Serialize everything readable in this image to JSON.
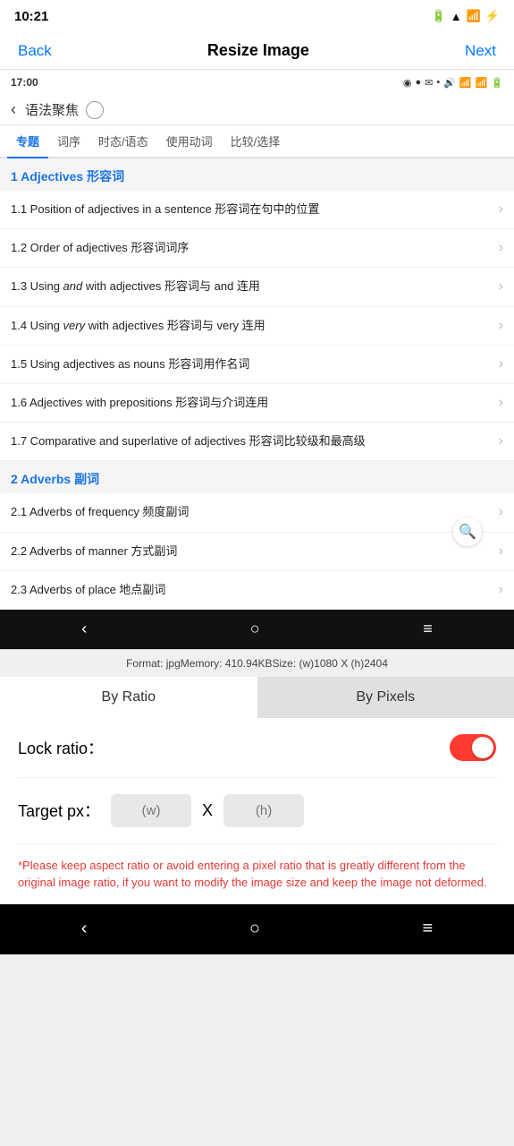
{
  "statusBar": {
    "time": "10:21",
    "icons": [
      "◉",
      "✉",
      "✉",
      "•"
    ]
  },
  "topNav": {
    "backLabel": "Back",
    "title": "Resize Image",
    "nextLabel": "Next"
  },
  "innerPhone": {
    "statusBar": {
      "time": "17:00",
      "icons": [
        "◉",
        "●",
        "✉",
        "•",
        "📶",
        "WiFi",
        "📶",
        "🔋"
      ]
    },
    "navTitle": "语法聚焦",
    "tabs": [
      "专题",
      "词序",
      "时态/语态",
      "使用动词",
      "比较/选择"
    ],
    "activeTab": 0,
    "sections": [
      {
        "title": "1 Adjectives 形容词",
        "items": [
          "1.1 Position of adjectives in a sentence 形容词在句中的位置",
          "1.2 Order of adjectives 形容词词序",
          "1.3 Using and with adjectives 形容词与 and 连用",
          "1.4 Using very with adjectives 形容词与 very 连用",
          "1.5 Using adjectives as nouns 形容词用作名词",
          "1.6 Adjectives with prepositions 形容词与介词连用",
          "1.7 Comparative and superlative of adjectives 形容词比较级和最高级"
        ]
      },
      {
        "title": "2 Adverbs 副词",
        "items": [
          "2.1 Adverbs of frequency 频度副词",
          "2.2 Adverbs of manner 方式副词",
          "2.3 Adverbs of place 地点副词"
        ]
      }
    ],
    "bottomBar": {
      "buttons": [
        "‹",
        "○",
        "≡"
      ]
    }
  },
  "formatInfo": "Format: jpgMemory: 410.94KBSize: (w)1080 X (h)2404",
  "tabSelector": {
    "options": [
      "By Ratio",
      "By Pixels"
    ],
    "activeIndex": 0
  },
  "settings": {
    "lockRatioLabel": "Lock ratio：",
    "targetPxLabel": "Target px：",
    "widthPlaceholder": "(w)",
    "xLabel": "X",
    "heightPlaceholder": "(h)"
  },
  "warningText": "*Please keep aspect ratio or avoid entering a pixel ratio that is greatly different from the original image ratio, if you want to modify the image size and keep the image not deformed.",
  "systemBar": {
    "buttons": [
      "‹",
      "○",
      "≡"
    ]
  }
}
